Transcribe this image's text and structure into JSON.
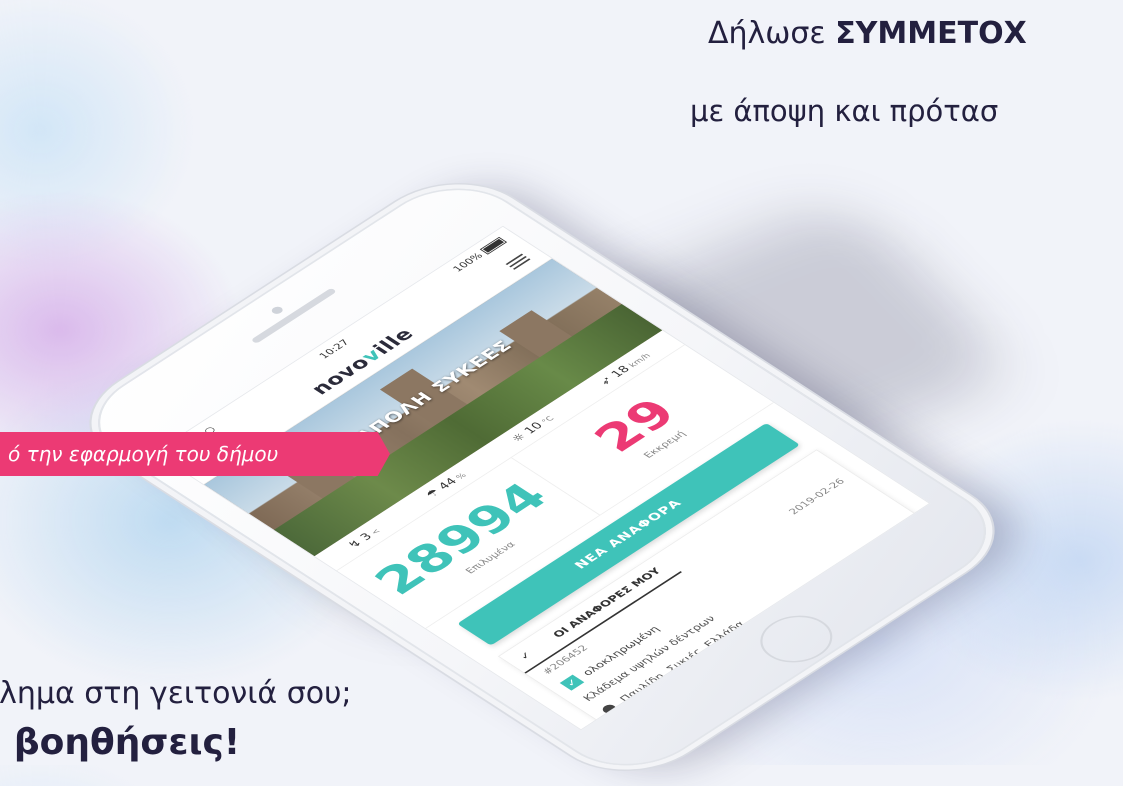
{
  "headlines": {
    "line1_normal": "Δήλωσε ",
    "line1_bold": "ΣΥΜΜΕΤΟΧ",
    "line2": "με άποψη και πρότασ",
    "tag": "ό την εφαρμογή του δήμου",
    "line3": "βλημα στη γειτονιά σου;",
    "line4": "ς βοηθήσεις!"
  },
  "phone": {
    "status": {
      "carrier": "●●●○○ ",
      "time": "10:27",
      "battery": "100%"
    },
    "logo_prefix": "novo",
    "logo_accent": "v",
    "logo_suffix": "ille",
    "hero_title": "ΝΕΑΠΟΛΗ ΣΥΚΕΕΣ",
    "weather": [
      {
        "icon": "wind-icon",
        "value": "3",
        "unit": "<"
      },
      {
        "icon": "humidity-icon",
        "value": "44",
        "unit": "%"
      },
      {
        "icon": "temperature-icon",
        "value": "10",
        "unit": "°C"
      },
      {
        "icon": "pressure-icon",
        "value": "18",
        "unit": "km/h"
      }
    ],
    "stats": [
      {
        "value": "28994",
        "label": "Επιλυμένα",
        "color": "#3fc3b9"
      },
      {
        "value": "29",
        "label": "Εκκρεμή",
        "color": "#ec3a74"
      }
    ],
    "new_report_button": "ΝΕΑ ΑΝΑΦΟΡΑ",
    "my_reports": {
      "title": "ΟΙ ΑΝΑΦΟΡΕΣ ΜΟΥ",
      "id": "#206452",
      "date": "2019-02-26",
      "status": "ολοκληρωμένη",
      "description": "Κλάδεμα υψηλών δέντρων",
      "location": "Παυλίδη, Συκιές, Ελλάδα"
    }
  },
  "colors": {
    "accent": "#3fc3b9",
    "pink": "#ec3a74",
    "text_dark": "#23203f"
  }
}
